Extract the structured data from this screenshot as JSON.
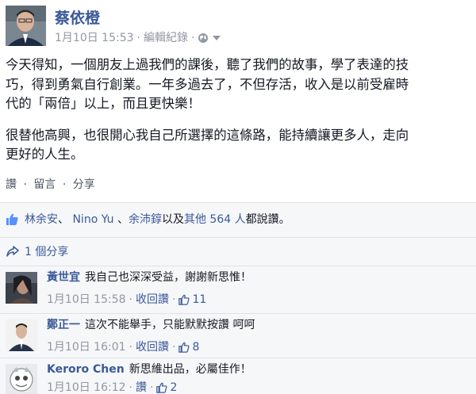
{
  "post": {
    "author": "蔡依橙",
    "date": "1月10日 15:53",
    "separator": "·",
    "edit_history": "編輯紀錄",
    "paragraphs": [
      "今天得知，一個朋友上過我們的課後，聽了我們的故事，學了表達的技",
      "巧，得到勇氣自行創業。一年多過去了，不但存活，收入是以前受雇時",
      "代的「兩倍」以上，而且更快樂！",
      "很替他高興，也很開心我自己所選擇的這條路，能持續讓更多人，走向",
      "更好的人生。"
    ]
  },
  "actions": {
    "like": "讚",
    "comment": "留言",
    "share": "分享",
    "dot": "·"
  },
  "likes_summary": {
    "name1": "林余安",
    "sep1": "、",
    "name2": "Nino Yu",
    "sep2": "、",
    "name3": "余沛錞",
    "mid": "以及",
    "others": "其他 564 人",
    "suffix": "都說讚。"
  },
  "shares": {
    "label": "1 個分享"
  },
  "comments": [
    {
      "name": "黃世宜",
      "text": "我自己也深深受益，謝謝新思惟！",
      "date": "1月10日 15:58",
      "action": "收回讚",
      "likes": "11"
    },
    {
      "name": "鄭正一",
      "text": "這次不能舉手，只能默默按讚 呵呵",
      "date": "1月10日 16:01",
      "action": "收回讚",
      "likes": "8"
    },
    {
      "name": "Keroro Chen",
      "text": "新思維出品，必屬佳作！",
      "date": "1月10日 16:12",
      "action": "讚",
      "likes": "2"
    }
  ],
  "colors": {
    "link": "#3b5998",
    "meta": "#9197a3",
    "text": "#141823",
    "feedback_bg": "#f6f7f9"
  }
}
